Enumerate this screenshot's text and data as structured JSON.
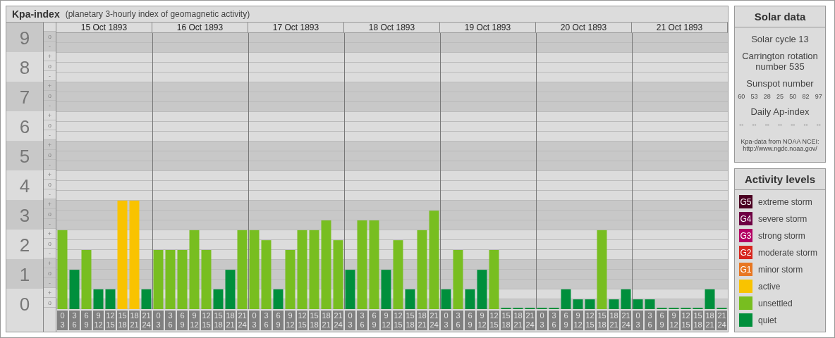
{
  "main_panel": {
    "subtitle": "(planetary 3-hourly index of geomagnetic activity)",
    "days": [
      "15 Oct 1893",
      "16 Oct 1893",
      "17 Oct 1893",
      "18 Oct 1893",
      "19 Oct 1893",
      "20 Oct 1893",
      "21 Oct 1893"
    ],
    "sub_scale": [
      "o",
      "-",
      "+",
      "o",
      "-",
      "+",
      "o",
      "-",
      "+",
      "o",
      "-",
      "+",
      "o",
      "-",
      "+",
      "o",
      "-",
      "+",
      "o",
      "-",
      "+",
      "o",
      "-",
      "+",
      "o",
      "-",
      "+",
      "o"
    ],
    "chart_data": {
      "type": "bar",
      "title": "Kpa-index",
      "grid": true,
      "ylim": [
        0,
        9
      ],
      "yticks": [
        0,
        1,
        2,
        3,
        4,
        5,
        6,
        7,
        8,
        9
      ],
      "categories": [
        "0\n3",
        "3\n6",
        "6\n9",
        "9\n12",
        "12\n15",
        "15\n18",
        "18\n21",
        "21\n24",
        "0\n3",
        "3\n6",
        "6\n9",
        "9\n12",
        "12\n15",
        "15\n18",
        "18\n21",
        "21\n24",
        "0\n3",
        "3\n6",
        "6\n9",
        "9\n12",
        "12\n15",
        "15\n18",
        "18\n21",
        "21\n24",
        "0\n3",
        "3\n6",
        "6\n9",
        "9\n12",
        "12\n15",
        "15\n18",
        "18\n21",
        "21\n24",
        "0\n3",
        "3\n6",
        "6\n9",
        "9\n12",
        "12\n15",
        "15\n18",
        "18\n21",
        "21\n24",
        "0\n3",
        "3\n6",
        "6\n9",
        "9\n12",
        "12\n15",
        "15\n18",
        "18\n21",
        "21\n24",
        "0\n3",
        "3\n6",
        "6\n9",
        "9\n12",
        "12\n15",
        "15\n18",
        "18\n21",
        "21\n24"
      ],
      "series": [
        {
          "values": [
            2.67,
            1.33,
            2,
            0.67,
            0.67,
            3.67,
            3.67,
            0.67,
            2,
            2,
            2,
            2.67,
            2,
            0.67,
            1.33,
            2.67,
            2.67,
            2.33,
            0.67,
            2,
            2.67,
            2.67,
            3,
            2.33,
            1.33,
            3,
            3,
            1.33,
            2.33,
            0.67,
            2.67,
            3.33,
            0.67,
            2,
            0.67,
            1.33,
            2,
            0,
            0,
            0,
            0,
            0,
            0.67,
            0.33,
            0.33,
            2.67,
            0.33,
            0.67,
            0.33,
            0.33,
            0,
            0,
            0,
            0,
            0.67,
            0
          ]
        }
      ]
    }
  },
  "solar_data": {
    "title": "Solar data",
    "solar_cycle": "Solar cycle 13",
    "carrington": "Carrington rotation number 535",
    "sunspot_label": "Sunspot number",
    "sunspot_numbers": [
      "60",
      "53",
      "28",
      "25",
      "50",
      "82",
      "97"
    ],
    "ap_label": "Daily Ap-index",
    "ap_values": [
      "--",
      "--",
      "--",
      "--",
      "--",
      "--",
      "--"
    ],
    "source": "Kpa-data from NOAA NCEI:",
    "source_url": "http://www.ngdc.noaa.gov/"
  },
  "activity_levels": {
    "title": "Activity levels",
    "items": [
      {
        "badge": "G5",
        "label": "extreme storm",
        "color": "#4b0022"
      },
      {
        "badge": "G4",
        "label": "severe storm",
        "color": "#6e0043"
      },
      {
        "badge": "G3",
        "label": "strong storm",
        "color": "#b40064"
      },
      {
        "badge": "G2",
        "label": "moderate storm",
        "color": "#d7261e"
      },
      {
        "badge": "G1",
        "label": "minor storm",
        "color": "#e87722"
      },
      {
        "label": "active",
        "color": "#f9c300"
      },
      {
        "label": "unsettled",
        "color": "#78be20"
      },
      {
        "label": "quiet",
        "color": "#008f3c"
      }
    ]
  }
}
